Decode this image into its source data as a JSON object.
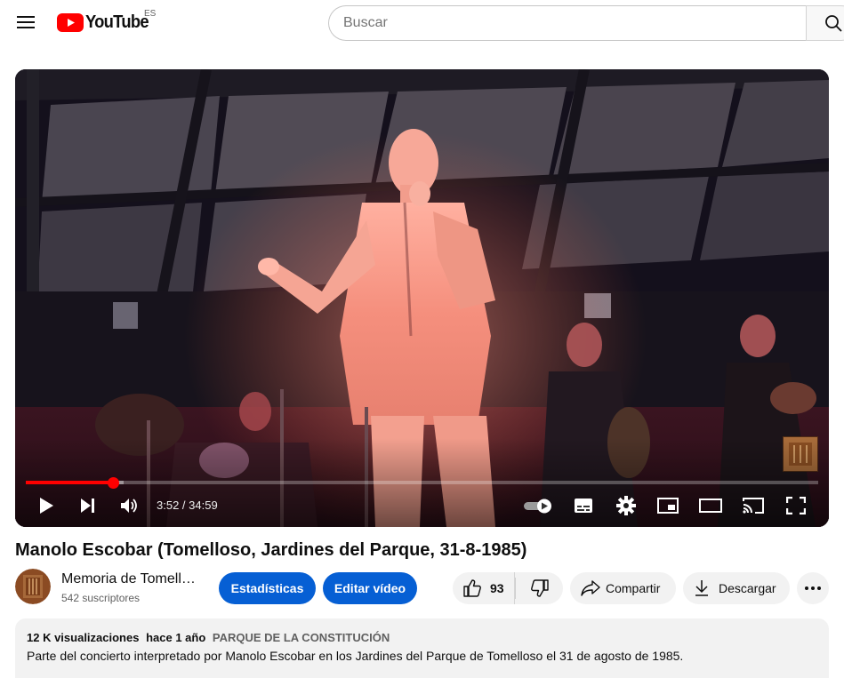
{
  "masthead": {
    "logo_text": "YouTube",
    "country_code": "ES",
    "search_placeholder": "Buscar",
    "brand_color": "#ff0000"
  },
  "player": {
    "time_current": "3:52",
    "time_total": "34:59",
    "time_display": "3:52 / 34:59",
    "progress_fraction": 0.1105,
    "buffered_fraction": 0.124,
    "accent": "#ff0000",
    "controls": [
      "play-icon",
      "next-icon",
      "volume-icon",
      "autoplay-toggle-icon",
      "subtitles-icon",
      "settings-icon",
      "miniplayer-icon",
      "theater-mode-icon",
      "cast-icon",
      "fullscreen-icon"
    ]
  },
  "video": {
    "title": "Manolo Escobar (Tomelloso, Jardines del Parque, 31-8-1985)"
  },
  "owner": {
    "channel_name": "Memoria de Tomelloso",
    "subscribers": "542 suscriptores",
    "stats_button": "Estadísticas",
    "edit_button": "Editar vídeo",
    "button_color": "#065fd4"
  },
  "actions": {
    "likes": "93",
    "share_label": "Compartir",
    "download_label": "Descargar"
  },
  "description": {
    "views": "12 K visualizaciones",
    "date": "hace 1 año",
    "tag": "PARQUE DE LA CONSTITUCIÓN",
    "text": "Parte del concierto interpretado por Manolo Escobar en los Jardines del Parque de Tomelloso el 31 de agosto de 1985."
  }
}
